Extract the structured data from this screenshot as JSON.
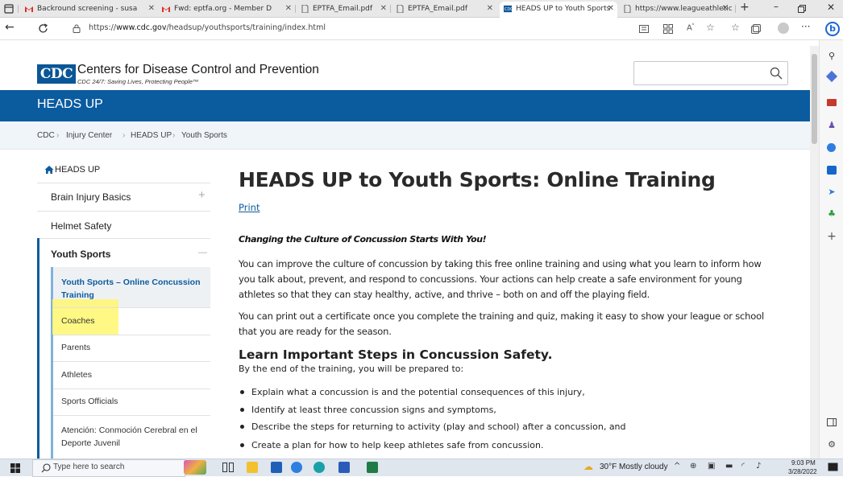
{
  "browser": {
    "tabs": [
      {
        "label": "Backround screening - susa",
        "icon": "gmail-icon"
      },
      {
        "label": "Fwd: eptfa.org - Member D",
        "icon": "gmail-icon"
      },
      {
        "label": "EPTFA_Email.pdf",
        "icon": "pdf-icon"
      },
      {
        "label": "EPTFA_Email.pdf",
        "icon": "pdf-icon"
      },
      {
        "label": "HEADS UP to Youth Sports",
        "icon": "cdc-icon"
      },
      {
        "label": "https://www.leagueathletics",
        "icon": "page-icon"
      }
    ],
    "active_tab_index": 4,
    "url_prefix": "https://",
    "url_domain": "www.cdc.gov",
    "url_path": "/headsup/youthsports/training/index.html",
    "colors": {
      "accent": "#0b5b9f",
      "tabbar": "#e8e8e8"
    }
  },
  "site": {
    "logo_text": "CDC",
    "org_name": "Centers for Disease Control and Prevention",
    "tagline": "CDC 24/7: Saving Lives, Protecting People™",
    "banner_title": "HEADS UP",
    "search_placeholder": ""
  },
  "breadcrumb": [
    "CDC",
    "Injury Center",
    "HEADS UP",
    "Youth Sports"
  ],
  "sidenav": {
    "home": "HEADS UP",
    "items": [
      {
        "label": "Brain Injury Basics",
        "toggle": "+"
      },
      {
        "label": "Helmet Safety"
      },
      {
        "label": "Youth Sports",
        "toggle": "—"
      }
    ],
    "subitems": [
      "Youth Sports – Online Concussion Training",
      "Coaches",
      "Parents",
      "Athletes",
      "Sports Officials",
      "Atención: Conmoción Cerebral en el Deporte Juvenil"
    ]
  },
  "main": {
    "heading": "HEADS UP to Youth Sports: Online Training",
    "print": "Print",
    "intro": "Changing the Culture of Concussion Starts With You!",
    "para1": "You can improve the culture of concussion by taking this free online training and using what you learn to inform how you talk about, prevent, and respond to concussions. Your actions can help create a safe environment for young athletes so that they can stay healthy, active, and thrive – both on and off the playing field.",
    "para2": "You can print out a certificate once you complete the training and quiz, making it easy to show your league or school that you are ready for the season.",
    "subheading": "Learn Important Steps in Concussion Safety.",
    "subintro": "By the end of the training, you will be prepared to:",
    "bullets": [
      "Explain what a concussion is and the potential consequences of this injury,",
      "Identify at least three concussion signs and symptoms,",
      "Describe the steps for returning to activity (play and school) after a concussion, and",
      "Create a plan for how to help keep athletes safe from concussion."
    ]
  },
  "taskbar": {
    "search_placeholder": "Type here to search",
    "weather": "30°F  Mostly cloudy",
    "time": "9:03 PM",
    "date": "3/28/2022"
  }
}
